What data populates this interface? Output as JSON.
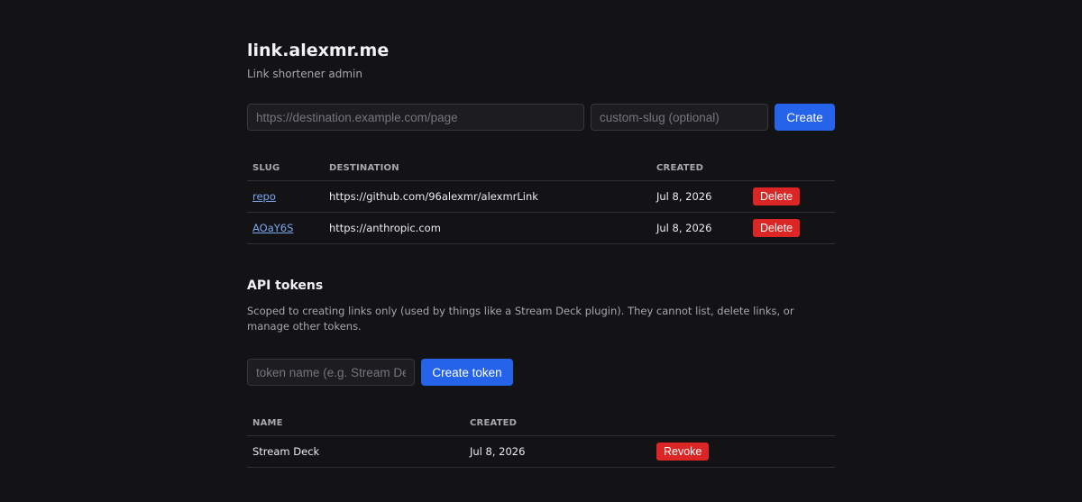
{
  "header": {
    "title": "link.alexmr.me",
    "subtitle": "Link shortener admin"
  },
  "create_form": {
    "destination_placeholder": "https://destination.example.com/page",
    "slug_placeholder": "custom-slug (optional)",
    "create_label": "Create"
  },
  "links_table": {
    "columns": [
      "SLUG",
      "DESTINATION",
      "CREATED",
      ""
    ],
    "rows": [
      {
        "slug": "repo",
        "destination": "https://github.com/96alexmr/alexmrLink",
        "created": "Jul 8, 2026",
        "action": "Delete"
      },
      {
        "slug": "AOaY6S",
        "destination": "https://anthropic.com",
        "created": "Jul 8, 2026",
        "action": "Delete"
      }
    ]
  },
  "api_tokens": {
    "title": "API tokens",
    "description": "Scoped to creating links only (used by things like a Stream Deck plugin). They cannot list, delete links, or manage other tokens.",
    "name_placeholder": "token name (e.g. Stream Deck)",
    "create_label": "Create token",
    "columns": [
      "NAME",
      "CREATED",
      ""
    ],
    "rows": [
      {
        "name": "Stream Deck",
        "created": "Jul 8, 2026",
        "action": "Revoke"
      }
    ]
  },
  "colors": {
    "background": "#131316",
    "primary": "#2563eb",
    "danger": "#dc2626",
    "link": "#7aa7f2"
  }
}
